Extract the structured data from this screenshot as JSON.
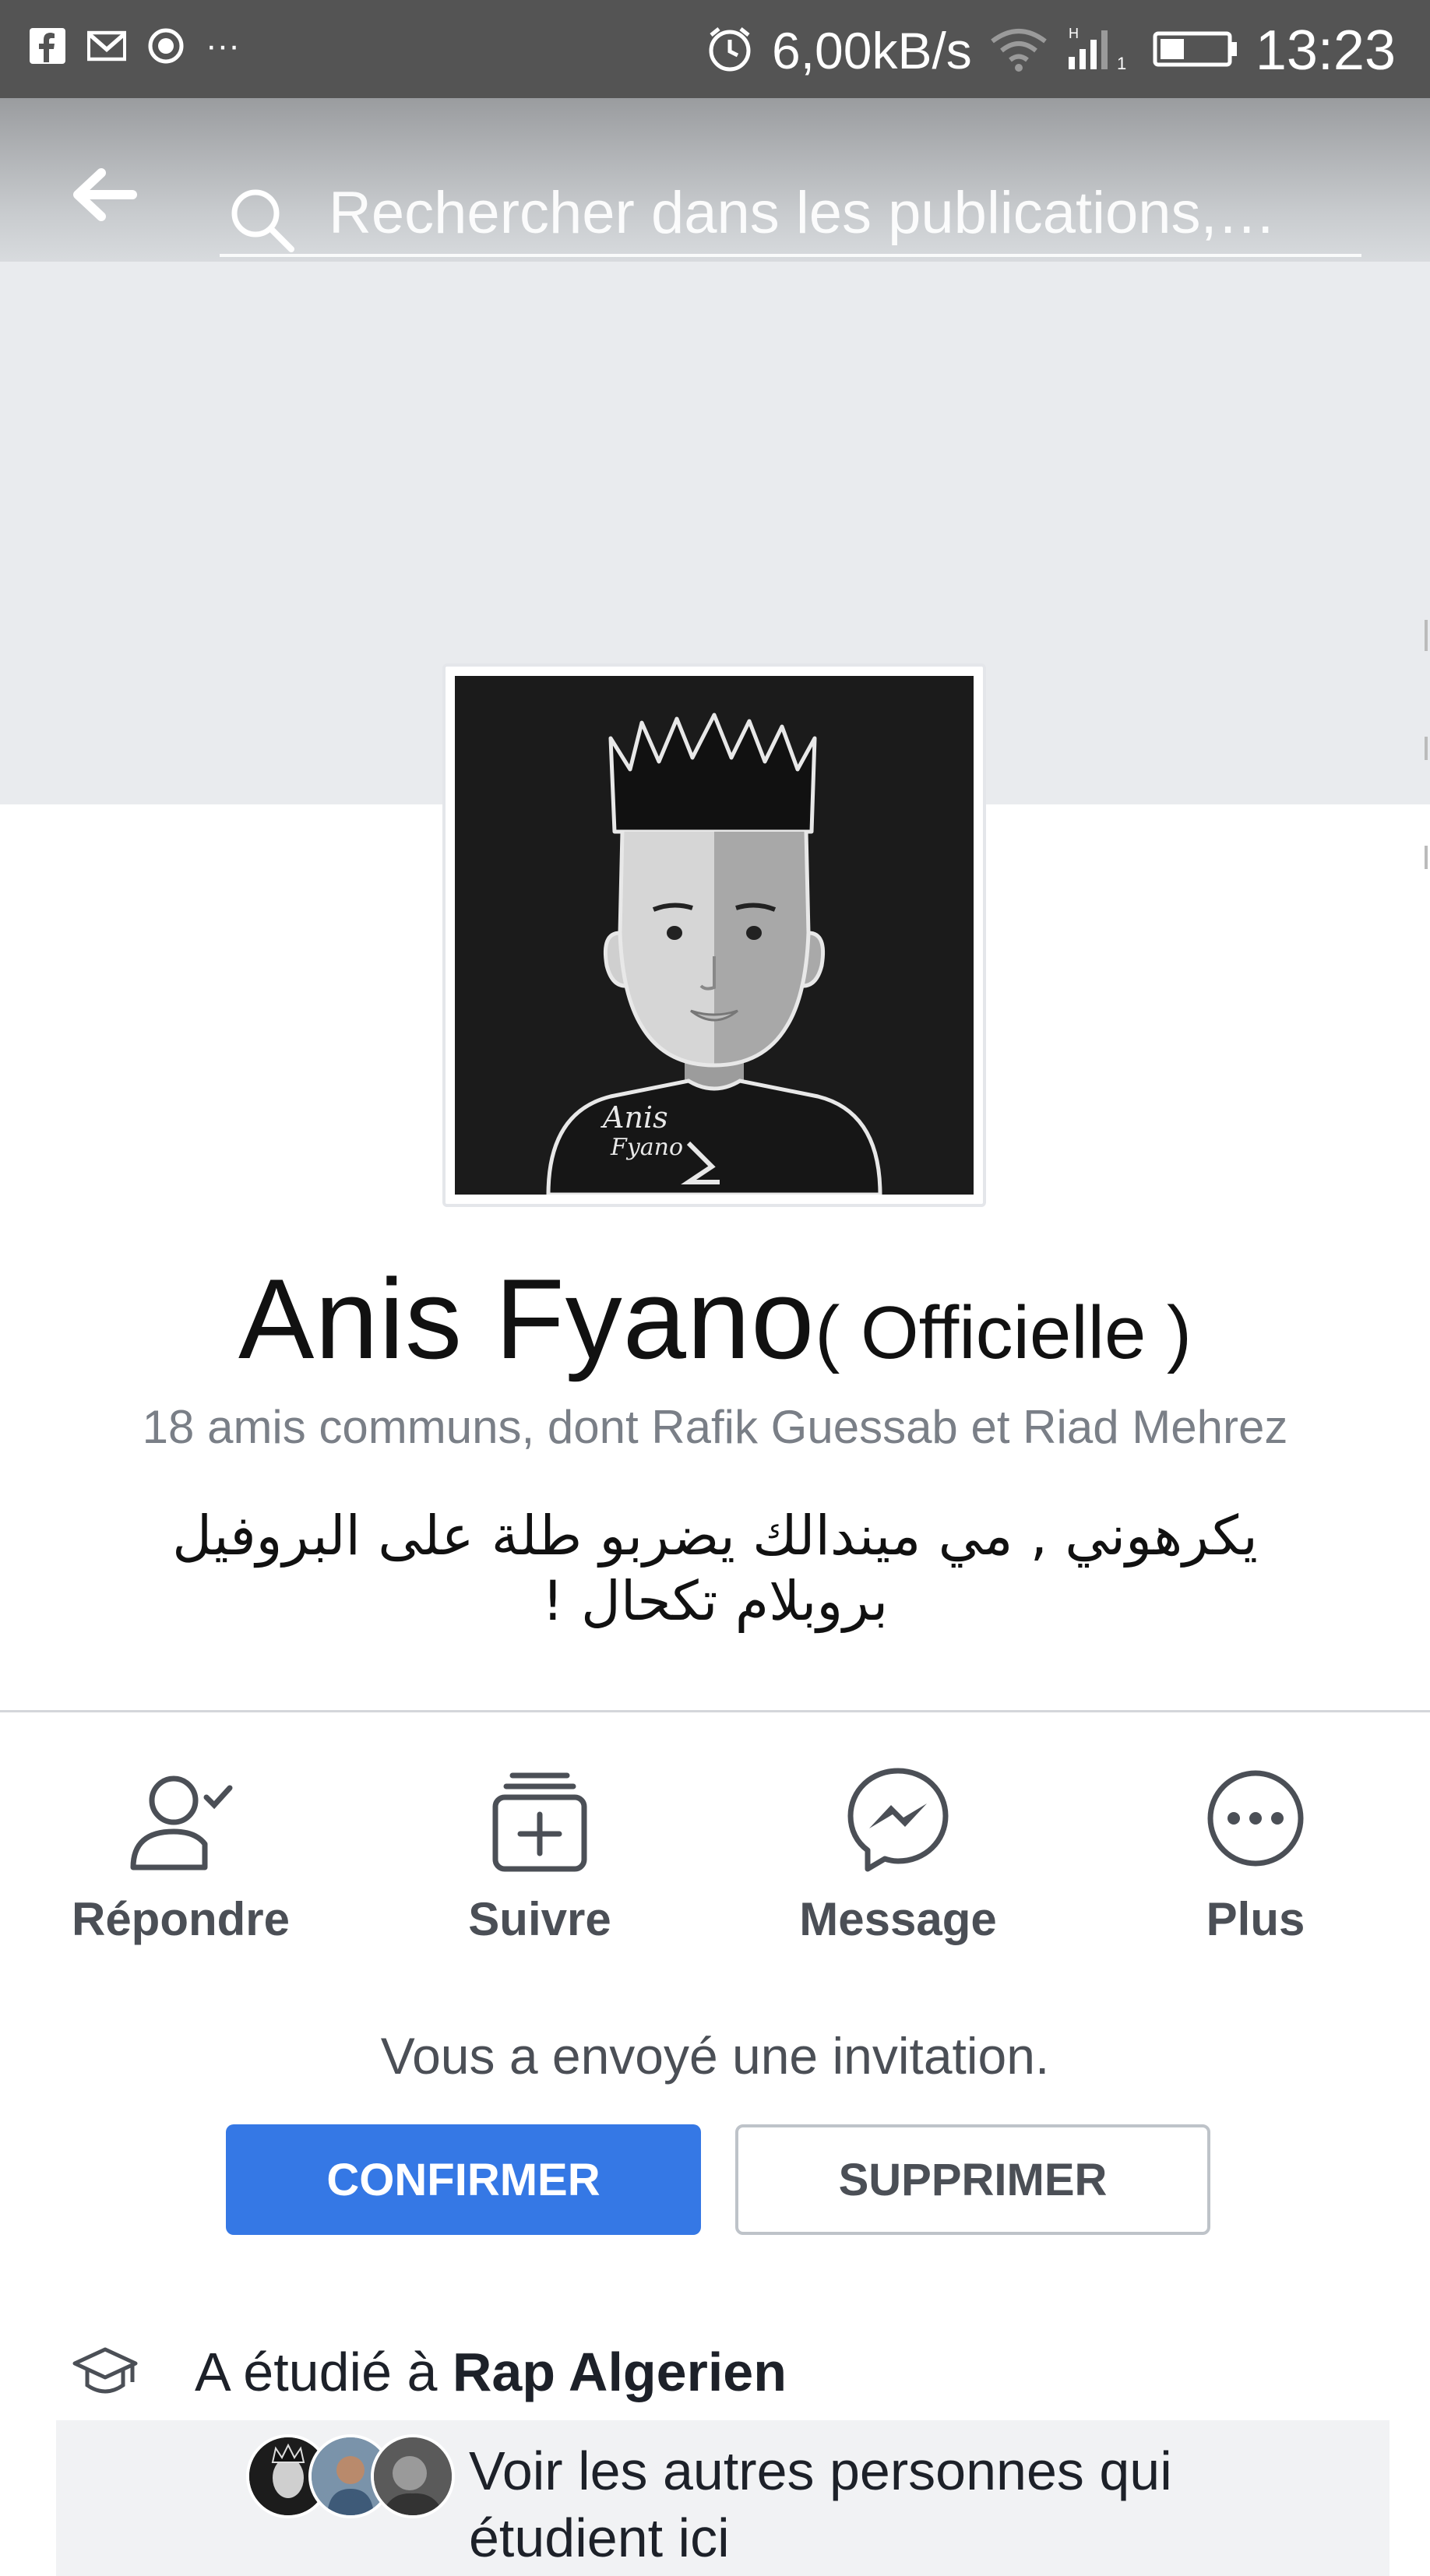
{
  "status_bar": {
    "left_icons": [
      "facebook-icon",
      "gmail-icon",
      "record-icon"
    ],
    "more": "···",
    "speed": "6,00kB/s",
    "time": "13:23",
    "right_icons": [
      "alarm-icon",
      "wifi-icon",
      "signal-icon",
      "battery-icon"
    ]
  },
  "header": {
    "search_placeholder": "Rechercher dans les publications,…"
  },
  "profile": {
    "name": "Anis Fyano",
    "name_suffix": "( Officielle )",
    "mutual_friends": "18 amis communs, dont Rafik Guessab et Riad Mehrez",
    "bio": "يكرهوني , مي ميندالك يضربو طلة على البروفيل بروبلام تكحال !"
  },
  "actions": [
    {
      "label": "Répondre",
      "icon": "person-check-icon"
    },
    {
      "label": "Suivre",
      "icon": "follow-stack-icon"
    },
    {
      "label": "Message",
      "icon": "messenger-icon"
    },
    {
      "label": "Plus",
      "icon": "more-icon"
    }
  ],
  "invitation": {
    "text": "Vous a envoyé une invitation.",
    "confirm_label": "CONFIRMER",
    "delete_label": "SUPPRIMER"
  },
  "education": {
    "prefix": "A étudié à ",
    "school": "Rap Algerien"
  },
  "others": {
    "text_line1": "Voir les autres personnes qui",
    "text_line2": "étudient ici"
  },
  "colors": {
    "accent": "#3578e5",
    "status_bar": "#545454",
    "cover": "#e9ebee"
  }
}
